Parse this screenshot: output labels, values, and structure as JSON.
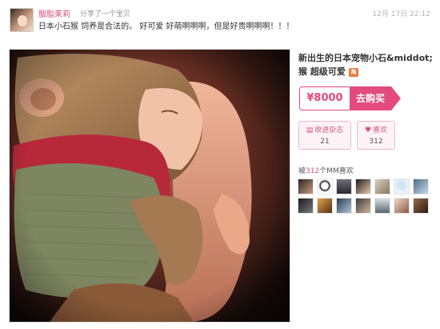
{
  "post": {
    "username": "胭脂茉莉",
    "action": "分享了一个宝贝",
    "timestamp": "12月 17日 22:12",
    "text": "日本小石猴 饲养是合法的。 好可爱 好萌啊啊啊，但是好贵啊啊啊！！！"
  },
  "product": {
    "title": "新出生的日本宠物小石&middot;猴 超级可爱",
    "badge_icon": "taobao-badge-icon",
    "price": "¥8000",
    "buy_label": "去购买"
  },
  "stats": {
    "collect_label": "收进杂志",
    "collect_icon": "magazine-icon",
    "collect_count": "21",
    "like_label": "喜欢",
    "like_icon": "heart-icon",
    "like_count": "312"
  },
  "liked_by": {
    "prefix": "被",
    "count": "312",
    "suffix": "个MM喜欢"
  },
  "colors": {
    "accent": "#e34b7c",
    "username": "#d2567f"
  }
}
